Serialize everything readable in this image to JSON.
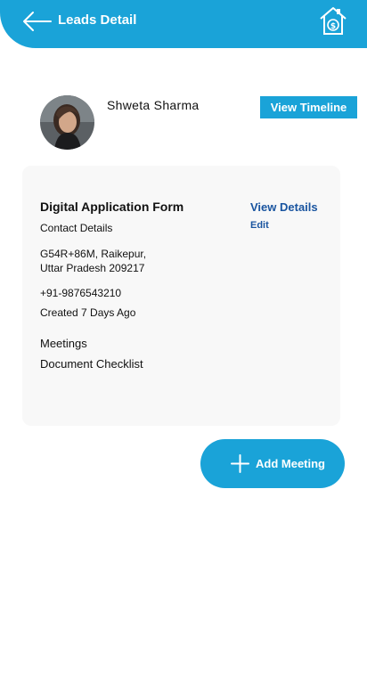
{
  "header": {
    "title": "Leads Detail"
  },
  "lead": {
    "name": "Shweta Sharma",
    "view_timeline_label": "View Timeline"
  },
  "card": {
    "form_title": "Digital Application Form",
    "view_details_label": "View Details",
    "edit_label": "Edit",
    "contact_label": "Contact Details",
    "address_line1": "G54R+86M, Raikepur,",
    "address_line2": "Uttar Pradesh 209217",
    "phone": "+91-9876543210",
    "created": "Created 7 Days Ago",
    "meetings_label": "Meetings",
    "document_checklist_label": "Document Checklist"
  },
  "actions": {
    "add_meeting_label": "Add Meeting"
  },
  "colors": {
    "accent": "#1aa3d8",
    "link": "#1a55a0",
    "card_bg": "#f8f8f8"
  },
  "icons": {
    "back": "back-arrow-icon",
    "home": "home-dollar-icon",
    "add": "plus-icon"
  }
}
